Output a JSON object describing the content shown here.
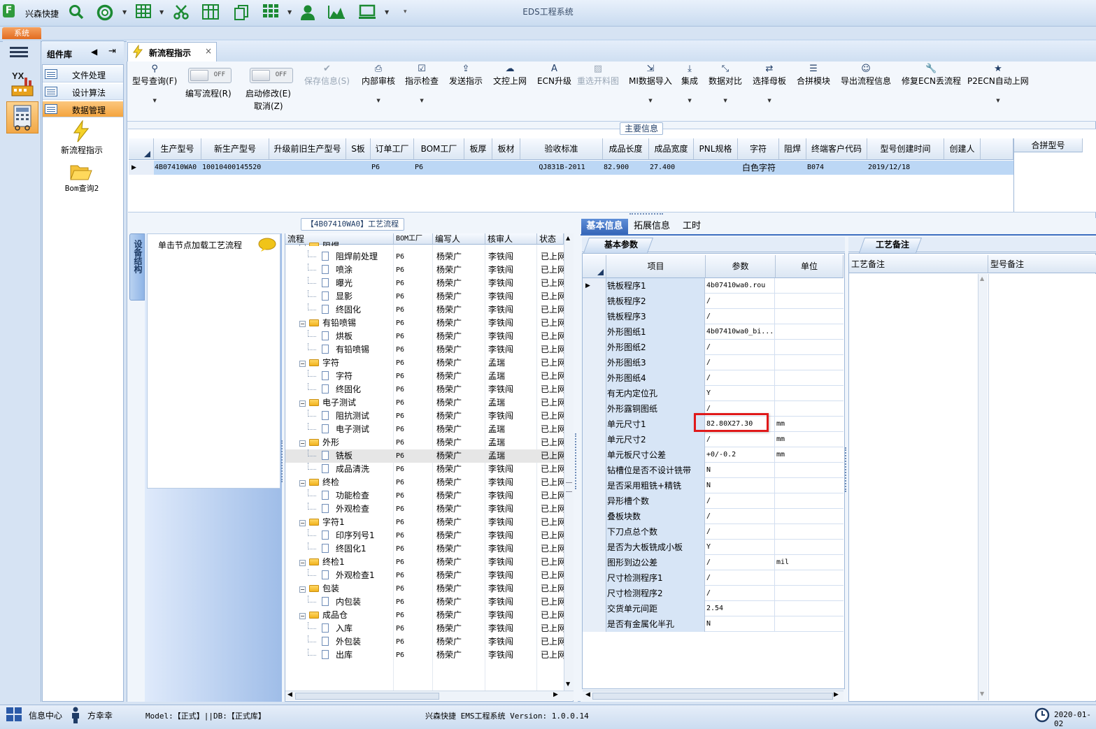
{
  "window": {
    "title": "EDS工程系统",
    "app_name": "兴森快捷",
    "system_tab": "系统"
  },
  "quick_icons": [
    "search-icon",
    "lifebuoy-icon",
    "table-icon",
    "scissors-icon",
    "grid-layout-icon",
    "copy-icon",
    "apps-icon",
    "user-icon",
    "area-chart-icon",
    "monitor-icon"
  ],
  "component_lib": {
    "title": "组件库",
    "items": [
      "文件处理",
      "设计算法",
      "数据管理"
    ],
    "selected": "数据管理",
    "tools": [
      "新流程指示",
      "Bom查询2"
    ]
  },
  "document_tab": {
    "label": "新流程指示"
  },
  "toolbar": {
    "query_model": "型号查询(F)",
    "toggle_off": "OFF",
    "edit_flow": "编写流程(R)",
    "start_edit": "启动修改(E)",
    "cancel": "取消(Z)",
    "save_info": "保存信息(S)",
    "buttons": [
      "内部审核",
      "指示检查",
      "发送指示",
      "文控上网",
      "ECN升级",
      "重选开料图",
      "MI数据导入",
      "集成",
      "数据对比",
      "选择母板",
      "合拼模块",
      "导出流程信息",
      "修复ECN丢流程",
      "P2ECN自动上网"
    ]
  },
  "main_info": {
    "title": "主要信息",
    "columns": [
      "生产型号",
      "新生产型号",
      "升级前旧生产型号",
      "S板",
      "订单工厂",
      "BOM工厂",
      "板厚",
      "板材",
      "验收标准",
      "成品长度",
      "成品宽度",
      "PNL规格",
      "字符",
      "阻焊",
      "终端客户代码",
      "型号创建时间",
      "创建人"
    ],
    "row": [
      "4B07410WA0",
      "10010400145520",
      "",
      "",
      "P6",
      "P6",
      "",
      "",
      "QJ831B-2011",
      "82.900",
      "27.400",
      "",
      "白色字符",
      "",
      "B074",
      "2019/12/18",
      ""
    ],
    "combine_header": "合拼型号"
  },
  "left_pane": {
    "side_tab": "设备结构",
    "hint": "单击节点加载工艺流程"
  },
  "process_tree": {
    "title": "【4B07410WA0】工艺流程",
    "columns": [
      "流程",
      "BOM工厂",
      "编写人",
      "核审人",
      "状态"
    ],
    "rows": [
      {
        "name": "阻焊",
        "level": 0,
        "factory": "",
        "writer": "",
        "reviewer": "",
        "status": "",
        "partial": true
      },
      {
        "name": "阻焊前处理",
        "level": 1,
        "factory": "P6",
        "writer": "杨荣广",
        "reviewer": "李铁闯",
        "status": "已上网"
      },
      {
        "name": "喷涂",
        "level": 1,
        "factory": "P6",
        "writer": "杨荣广",
        "reviewer": "李铁闯",
        "status": "已上网"
      },
      {
        "name": "曝光",
        "level": 1,
        "factory": "P6",
        "writer": "杨荣广",
        "reviewer": "李铁闯",
        "status": "已上网"
      },
      {
        "name": "显影",
        "level": 1,
        "factory": "P6",
        "writer": "杨荣广",
        "reviewer": "李铁闯",
        "status": "已上网"
      },
      {
        "name": "终固化",
        "level": 1,
        "factory": "P6",
        "writer": "杨荣广",
        "reviewer": "李铁闯",
        "status": "已上网"
      },
      {
        "name": "有铅喷锡",
        "level": 0,
        "factory": "P6",
        "writer": "杨荣广",
        "reviewer": "李铁闯",
        "status": "已上网"
      },
      {
        "name": "烘板",
        "level": 1,
        "factory": "P6",
        "writer": "杨荣广",
        "reviewer": "李铁闯",
        "status": "已上网"
      },
      {
        "name": "有铅喷锡",
        "level": 1,
        "factory": "P6",
        "writer": "杨荣广",
        "reviewer": "李铁闯",
        "status": "已上网"
      },
      {
        "name": "字符",
        "level": 0,
        "factory": "P6",
        "writer": "杨荣广",
        "reviewer": "孟瑞",
        "status": "已上网"
      },
      {
        "name": "字符",
        "level": 1,
        "factory": "P6",
        "writer": "杨荣广",
        "reviewer": "孟瑞",
        "status": "已上网"
      },
      {
        "name": "终固化",
        "level": 1,
        "factory": "P6",
        "writer": "杨荣广",
        "reviewer": "李铁闯",
        "status": "已上网"
      },
      {
        "name": "电子测试",
        "level": 0,
        "factory": "P6",
        "writer": "杨荣广",
        "reviewer": "孟瑞",
        "status": "已上网"
      },
      {
        "name": "阻抗测试",
        "level": 1,
        "factory": "P6",
        "writer": "杨荣广",
        "reviewer": "李铁闯",
        "status": "已上网"
      },
      {
        "name": "电子测试",
        "level": 1,
        "factory": "P6",
        "writer": "杨荣广",
        "reviewer": "孟瑞",
        "status": "已上网"
      },
      {
        "name": "外形",
        "level": 0,
        "factory": "P6",
        "writer": "杨荣广",
        "reviewer": "孟瑞",
        "status": "已上网"
      },
      {
        "name": "铣板",
        "level": 1,
        "factory": "P6",
        "writer": "杨荣广",
        "reviewer": "孟瑞",
        "status": "已上网",
        "selected": true
      },
      {
        "name": "成品清洗",
        "level": 1,
        "factory": "P6",
        "writer": "杨荣广",
        "reviewer": "李铁闯",
        "status": "已上网"
      },
      {
        "name": "终检",
        "level": 0,
        "factory": "P6",
        "writer": "杨荣广",
        "reviewer": "李铁闯",
        "status": "已上网"
      },
      {
        "name": "功能检查",
        "level": 1,
        "factory": "P6",
        "writer": "杨荣广",
        "reviewer": "李铁闯",
        "status": "已上网"
      },
      {
        "name": "外观检查",
        "level": 1,
        "factory": "P6",
        "writer": "杨荣广",
        "reviewer": "李铁闯",
        "status": "已上网"
      },
      {
        "name": "字符1",
        "level": 0,
        "factory": "P6",
        "writer": "杨荣广",
        "reviewer": "李铁闯",
        "status": "已上网"
      },
      {
        "name": "印序列号1",
        "level": 1,
        "factory": "P6",
        "writer": "杨荣广",
        "reviewer": "李铁闯",
        "status": "已上网"
      },
      {
        "name": "终固化1",
        "level": 1,
        "factory": "P6",
        "writer": "杨荣广",
        "reviewer": "李铁闯",
        "status": "已上网"
      },
      {
        "name": "终检1",
        "level": 0,
        "factory": "P6",
        "writer": "杨荣广",
        "reviewer": "李铁闯",
        "status": "已上网"
      },
      {
        "name": "外观检查1",
        "level": 1,
        "factory": "P6",
        "writer": "杨荣广",
        "reviewer": "李铁闯",
        "status": "已上网"
      },
      {
        "name": "包装",
        "level": 0,
        "factory": "P6",
        "writer": "杨荣广",
        "reviewer": "李铁闯",
        "status": "已上网"
      },
      {
        "name": "内包装",
        "level": 1,
        "factory": "P6",
        "writer": "杨荣广",
        "reviewer": "李铁闯",
        "status": "已上网"
      },
      {
        "name": "成品仓",
        "level": 0,
        "factory": "P6",
        "writer": "杨荣广",
        "reviewer": "李铁闯",
        "status": "已上网"
      },
      {
        "name": "入库",
        "level": 1,
        "factory": "P6",
        "writer": "杨荣广",
        "reviewer": "李铁闯",
        "status": "已上网"
      },
      {
        "name": "外包装",
        "level": 1,
        "factory": "P6",
        "writer": "杨荣广",
        "reviewer": "李铁闯",
        "status": "已上网"
      },
      {
        "name": "出库",
        "level": 1,
        "factory": "P6",
        "writer": "杨荣广",
        "reviewer": "李铁闯",
        "status": "已上网"
      }
    ]
  },
  "right_tabs": [
    "基本信息",
    "拓展信息",
    "工时"
  ],
  "basic_params": {
    "tab": "基本参数",
    "columns": [
      "项目",
      "参数",
      "单位"
    ],
    "highlight_color": "#e0191a",
    "rows": [
      {
        "item": "铣板程序1",
        "value": "4b07410wa0.rou",
        "unit": ""
      },
      {
        "item": "铣板程序2",
        "value": "/",
        "unit": ""
      },
      {
        "item": "铣板程序3",
        "value": "/",
        "unit": ""
      },
      {
        "item": "外形图纸1",
        "value": "4b07410wa0_bi...",
        "unit": ""
      },
      {
        "item": "外形图纸2",
        "value": "/",
        "unit": ""
      },
      {
        "item": "外形图纸3",
        "value": "/",
        "unit": ""
      },
      {
        "item": "外形图纸4",
        "value": "/",
        "unit": ""
      },
      {
        "item": "有无内定位孔",
        "value": "Y",
        "unit": ""
      },
      {
        "item": "外形露铜图纸",
        "value": "/",
        "unit": ""
      },
      {
        "item": "单元尺寸1",
        "value": "82.80X27.30",
        "unit": "mm",
        "highlighted": true
      },
      {
        "item": "单元尺寸2",
        "value": "/",
        "unit": "mm"
      },
      {
        "item": "单元板尺寸公差",
        "value": "+0/-0.2",
        "unit": "mm"
      },
      {
        "item": "钻槽位是否不设计铣带",
        "value": "N",
        "unit": ""
      },
      {
        "item": "是否采用粗铣+精铣",
        "value": "N",
        "unit": ""
      },
      {
        "item": "异形槽个数",
        "value": "/",
        "unit": ""
      },
      {
        "item": "叠板块数",
        "value": "/",
        "unit": ""
      },
      {
        "item": "下刀点总个数",
        "value": "/",
        "unit": ""
      },
      {
        "item": "是否为大板铣成小板",
        "value": "Y",
        "unit": ""
      },
      {
        "item": "图形到边公差",
        "value": "/",
        "unit": "mil"
      },
      {
        "item": "尺寸检测程序1",
        "value": "/",
        "unit": ""
      },
      {
        "item": "尺寸检测程序2",
        "value": "/",
        "unit": ""
      },
      {
        "item": "交货单元间距",
        "value": "2.54",
        "unit": ""
      },
      {
        "item": "是否有金属化半孔",
        "value": "N",
        "unit": ""
      }
    ]
  },
  "remarks": {
    "tab": "工艺备注",
    "process_remark": "工艺备注",
    "model_remark": "型号备注"
  },
  "status_bar": {
    "info_center": "信息中心",
    "user": "方幸幸",
    "model_db": "Model:【正式】||DB:【正式库】",
    "version": "兴森快捷 EMS工程系统 Version: 1.0.0.14",
    "date": "2020-01-02"
  }
}
